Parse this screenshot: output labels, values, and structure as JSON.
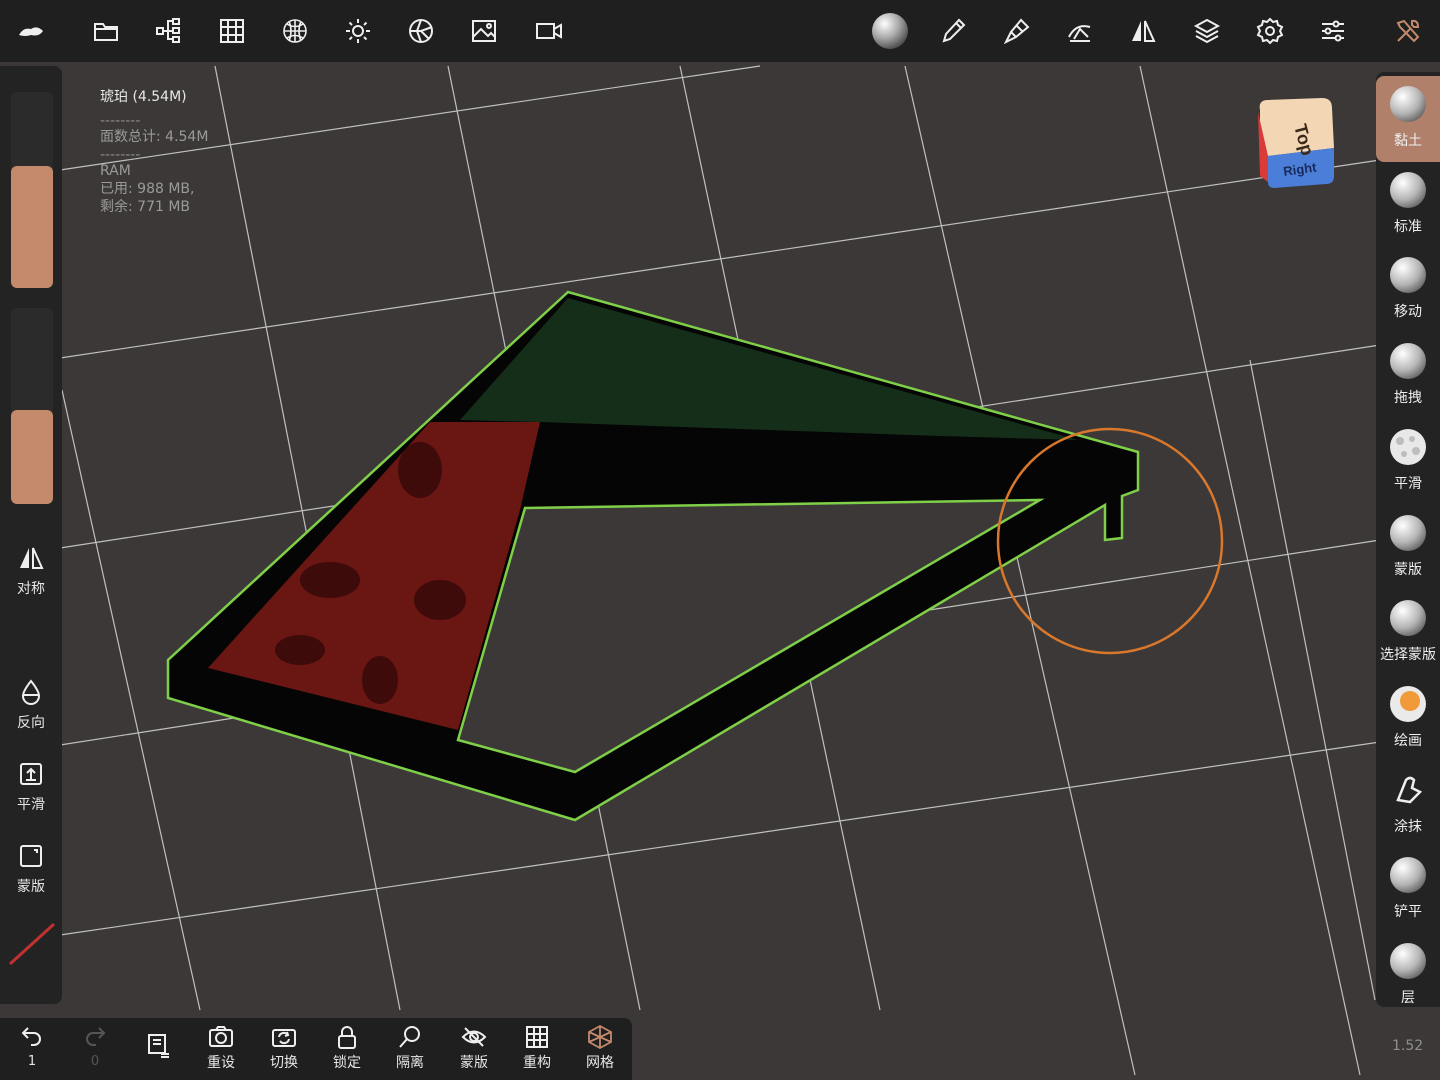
{
  "app": {
    "name": "Nomad Sculpt"
  },
  "stats": {
    "object_name": "琥珀 (4.54M)",
    "separator": "--------",
    "faces_total": "面数总计:  4.54M",
    "ram_label": "RAM",
    "ram_used": "已用:  988 MB,",
    "ram_free": "剩余:  771 MB"
  },
  "top_toolbar": [
    {
      "icon": "logo-icon"
    },
    {
      "icon": "folder-icon"
    },
    {
      "icon": "scene-tree-icon"
    },
    {
      "icon": "grid-icon"
    },
    {
      "icon": "material-sphere-icon"
    },
    {
      "icon": "sun-icon"
    },
    {
      "icon": "shading-icon"
    },
    {
      "icon": "image-icon"
    },
    {
      "icon": "video-icon"
    },
    {
      "icon": "matcap-sphere-icon"
    },
    {
      "icon": "brush-pen-icon"
    },
    {
      "icon": "brush-settings-icon"
    },
    {
      "icon": "stroke-icon"
    },
    {
      "icon": "symmetry-icon"
    },
    {
      "icon": "layers-icon"
    },
    {
      "icon": "settings-gear-icon"
    },
    {
      "icon": "sliders-icon"
    },
    {
      "icon": "tools-icon"
    }
  ],
  "left_panel": {
    "radius_value": 0.62,
    "intensity_value": 0.48,
    "items": [
      {
        "label": "对称",
        "icon": "symmetry-icon"
      },
      {
        "label": "反向",
        "icon": "drop-icon"
      },
      {
        "label": "平滑",
        "icon": "smooth-upload-icon"
      },
      {
        "label": "蒙版",
        "icon": "mask-square-icon"
      }
    ]
  },
  "right_tools": [
    {
      "label": "黏土",
      "active": true
    },
    {
      "label": "标准",
      "active": false
    },
    {
      "label": "移动",
      "active": false
    },
    {
      "label": "拖拽",
      "active": false
    },
    {
      "label": "平滑",
      "active": false
    },
    {
      "label": "蒙版",
      "active": false
    },
    {
      "label": "选择蒙版",
      "active": false
    },
    {
      "label": "绘画",
      "active": false
    },
    {
      "label": "涂抹",
      "active": false
    },
    {
      "label": "铲平",
      "active": false
    },
    {
      "label": "层",
      "active": false
    }
  ],
  "view_cube": {
    "top": "Top",
    "right": "Right"
  },
  "bottom_bar": {
    "undo_count": "1",
    "redo_count": "0",
    "items": [
      {
        "label": "重设",
        "icon": "reset-camera-icon"
      },
      {
        "label": "切换",
        "icon": "switch-camera-icon"
      },
      {
        "label": "锁定",
        "icon": "lock-icon"
      },
      {
        "label": "隔离",
        "icon": "isolate-search-icon"
      },
      {
        "label": "蒙版",
        "icon": "mask-hidden-icon"
      },
      {
        "label": "重构",
        "icon": "remesh-grid-icon"
      },
      {
        "label": "网格",
        "icon": "wireframe-icon"
      }
    ]
  },
  "version": "1.52",
  "colors": {
    "accent": "#c38a6c",
    "active_tool": "#b0806a",
    "selection_outline": "#7fd048",
    "brush_cursor": "#d9782c",
    "mesh_red": "#6e1410",
    "mesh_green": "#1f3a1a"
  }
}
